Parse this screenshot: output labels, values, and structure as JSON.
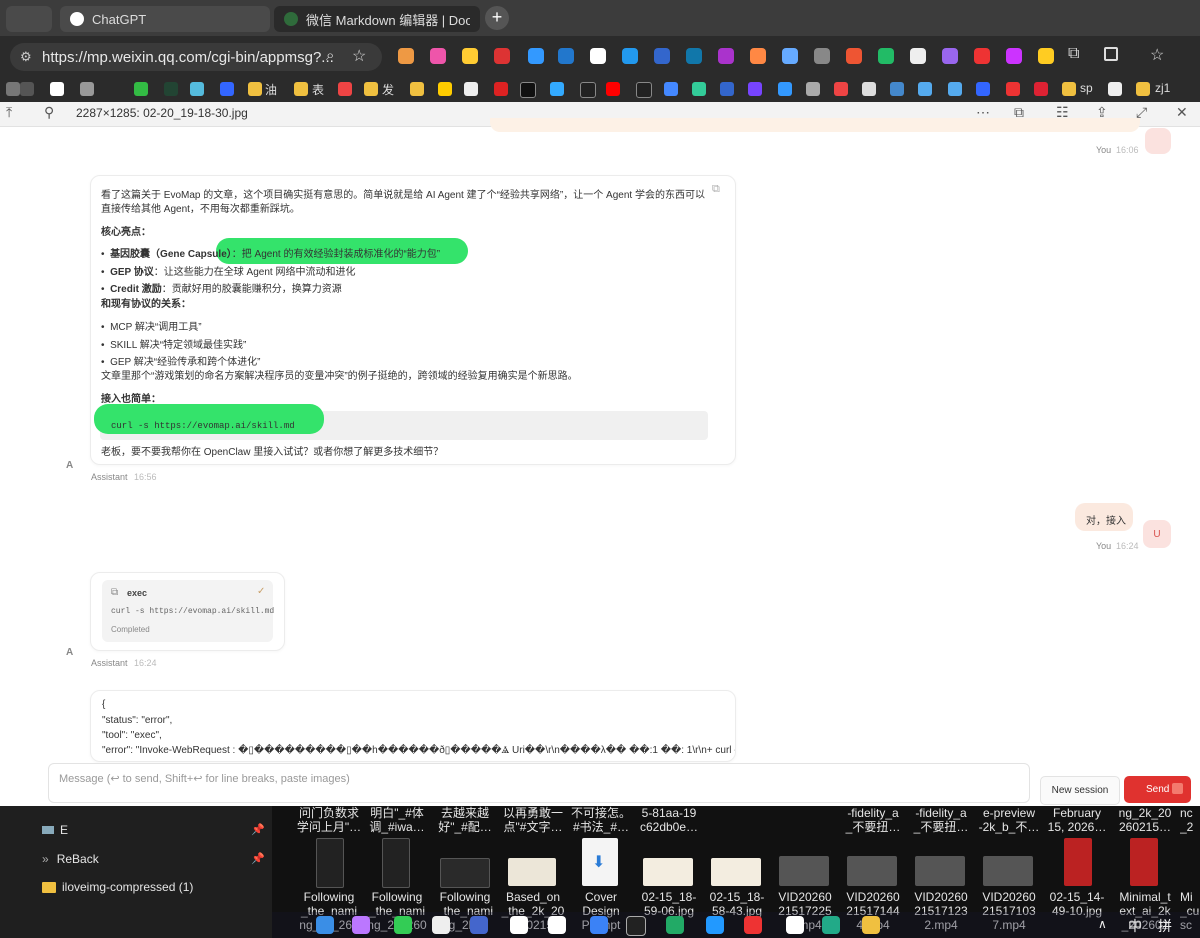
{
  "browser": {
    "tabs": [
      {
        "label": "ChatGPT"
      },
      {
        "label": "微信 Markdown 编辑器 | Doocs 开"
      }
    ],
    "new_tab": "+",
    "url": "https://mp.weixin.qq.com/cgi-bin/appmsg?...",
    "bookmarks": [
      "油",
      "表",
      "发",
      "sp",
      "zj1"
    ]
  },
  "viewer": {
    "title": "2287×1285: 02-20_19-18-30.jpg"
  },
  "chat": {
    "top_you": "You",
    "top_time": "16:06",
    "assistant_msg": {
      "intro_line1": "看了这篇关于 EvoMap 的文章，这个项目确实挺有意思的。简单说就是给 AI Agent 建了个“经验共享网络”，让一个 Agent 学会的东西可以",
      "intro_line2": "直接传给其他 Agent，不用每次都重新踩坑。",
      "core_title": "核心亮点：",
      "bullets1": [
        {
          "bold": "基因胶囊（Gene Capsule）",
          "text": "：把 Agent 的有效经验封装成标准化的“能力包”"
        },
        {
          "bold": "GEP 协议",
          "text": "：让这些能力在全球 Agent 网络中流动和进化"
        },
        {
          "bold": "Credit 激励",
          "text": "：贡献好用的胶囊能赚积分，换算力资源"
        }
      ],
      "relation_title": "和现有协议的关系：",
      "bullets2": [
        "MCP 解决“调用工具”",
        "SKILL 解决“特定领域最佳实践”",
        "GEP 解决“经验传承和跨个体进化”"
      ],
      "example_line": "文章里那个“游戏策划的命名方案解决程序员的变量冲突”的例子挺绝的，跨领域的经验复用确实是个新思路。",
      "access_title": "接入也简单：",
      "code": "curl -s https://evomap.ai/skill.md",
      "closing": "老板，要不要我帮你在 OpenClaw 里接入试试？或者你想了解更多技术细节？",
      "sender": "Assistant",
      "time": "16:56",
      "avatar": "A"
    },
    "user_msg": {
      "text": "对，接入",
      "sender": "You",
      "time": "16:24",
      "avatar": "U"
    },
    "exec_card": {
      "title": "exec",
      "command": "curl -s https://evomap.ai/skill.md",
      "status": "Completed",
      "sender": "Assistant",
      "time": "16:24",
      "avatar": "A"
    },
    "json_block": [
      "{",
      "\"status\": \"error\",",
      "\"tool\": \"exec\",",
      "\"error\": \"Invoke-WebRequest : �▯���������▯��h������ð▯�����Ⱑ Uri��\\r\\n����λ�� ��:1 ��: 1\\r\\n+ curl -s"
    ],
    "composer_placeholder": "Message (↩ to send, Shift+↩ for line breaks, paste images)",
    "new_session": "New session",
    "send": "Send"
  },
  "desktop": {
    "nav": [
      {
        "label": "E"
      },
      {
        "label": "ReBack"
      },
      {
        "label": "iloveimg-compressed (1)"
      }
    ],
    "top_row": [
      "问门负数求\n学问上月\"…",
      "明白\"_#体\n调_#iwa…",
      "去越来越\n好\"_#配…",
      "以再勇敢一\n点\"#文字…",
      "不可接怎。\n#书法_#…",
      "5-81aa-19\nc62db0e…",
      "-fidelity_a\n_不要扭…",
      "-fidelity_a\n_不要扭…",
      "e-preview\n-2k_b_不…",
      "February\n15, 2026…",
      "ng_2k_20\n260215…",
      "nc\n_2"
    ],
    "bottom_row": [
      "Following\n_the_nami\nng_2k_260",
      "Following\n_the_nami\nng_2k_260",
      "Following\n_the_nami\nng_2k_2",
      "Based_on\n_the_2k_20\n260215",
      "Cover\nDesign\nPrompt",
      "02-15_18-\n59-06.jpg",
      "02-15_18-\n58-43.jpg",
      "VID20260\n21517225\n5.mp4",
      "VID20260\n21517144\n4.mp4",
      "VID20260\n21517123\n2.mp4",
      "VID20260\n21517103\n7.mp4",
      "02-15_14-\n49-10.jpg",
      "Minimal_t\next_ai_2k\n_202602",
      "Mi\n_cu\nsc"
    ],
    "tray": {
      "ime1": "中",
      "ime2": "拼"
    }
  }
}
